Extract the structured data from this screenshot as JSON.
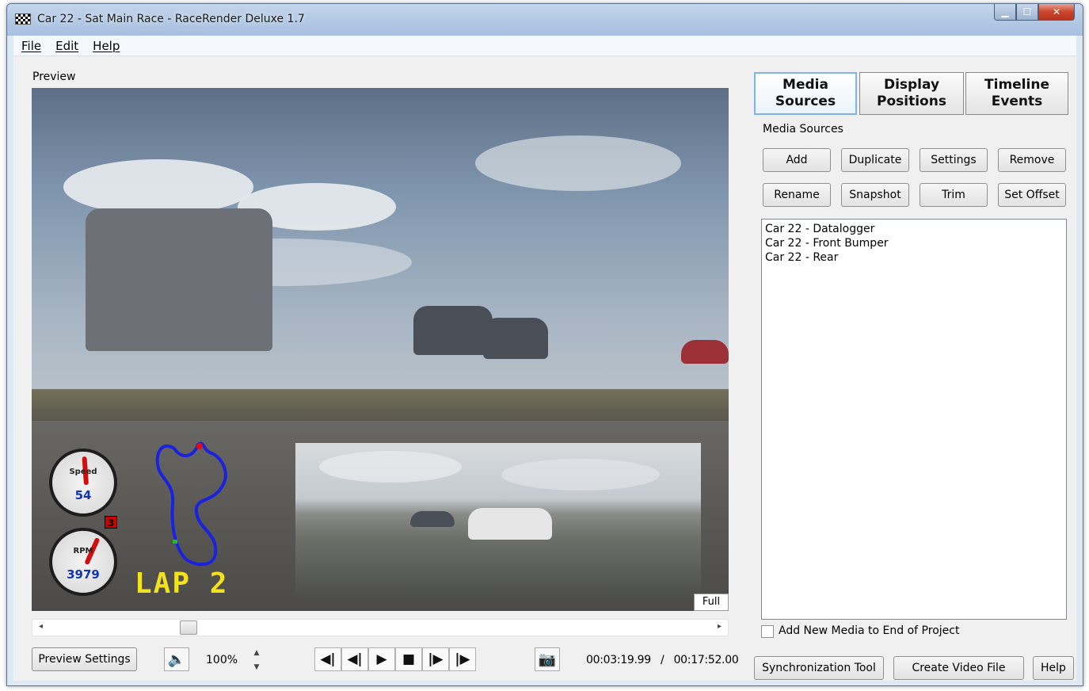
{
  "window": {
    "title": "Car 22 - Sat Main Race - RaceRender Deluxe 1.7",
    "minimize_icon": "minimize-icon",
    "maximize_icon": "maximize-icon",
    "close_icon": "close-icon"
  },
  "menu": {
    "items": [
      "File",
      "Edit",
      "Help"
    ]
  },
  "preview": {
    "label": "Preview",
    "speed_gauge": {
      "label": "Speed",
      "value": "54"
    },
    "rpm_gauge": {
      "label": "RPM",
      "value": "3979"
    },
    "gear": "3",
    "lap": "LAP 2",
    "pip_full_label": "Full"
  },
  "controls": {
    "preview_settings": "Preview Settings",
    "volume_icon": "speaker-icon",
    "zoom": "100%",
    "transport": [
      "step-back-icon",
      "frame-back-icon",
      "play-icon",
      "stop-icon",
      "frame-forward-icon",
      "step-forward-icon"
    ],
    "camera_icon": "camera-icon",
    "current_time": "00:03:19.99",
    "separator": "/",
    "total_time": "00:17:52.00"
  },
  "tabs": [
    {
      "line1": "Media",
      "line2": "Sources",
      "active": true
    },
    {
      "line1": "Display",
      "line2": "Positions",
      "active": false
    },
    {
      "line1": "Timeline",
      "line2": "Events",
      "active": false
    }
  ],
  "media_sources": {
    "label": "Media Sources",
    "buttons_row1": [
      "Add",
      "Duplicate",
      "Settings",
      "Remove"
    ],
    "buttons_row2": [
      "Rename",
      "Snapshot",
      "Trim",
      "Set Offset"
    ],
    "items": [
      "Car 22 - Datalogger",
      "Car 22 - Front Bumper",
      "Car 22 - Rear"
    ],
    "add_to_end_label": "Add New Media to End of Project",
    "add_to_end_checked": false
  },
  "bottom_buttons": [
    "Synchronization Tool",
    "Create Video File",
    "Help"
  ]
}
